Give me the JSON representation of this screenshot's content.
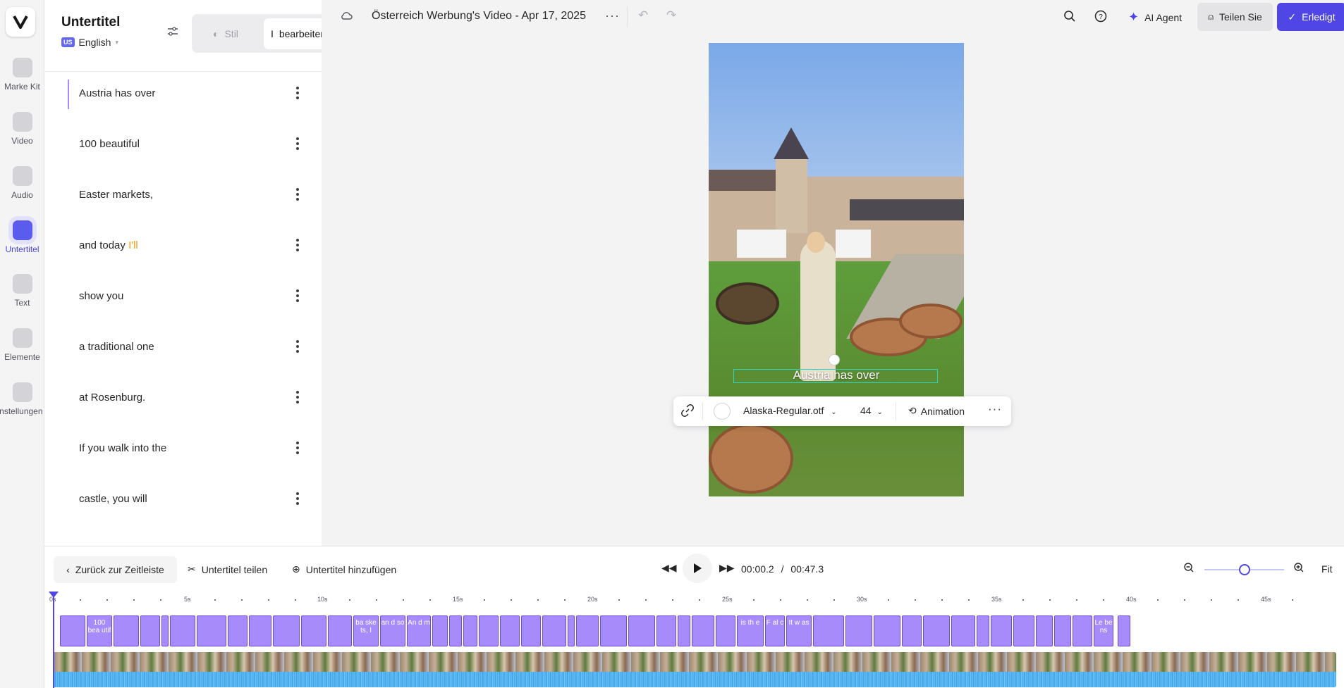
{
  "rail": {
    "items": [
      {
        "label": "Marke Kit",
        "icon": "brand-kit-icon"
      },
      {
        "label": "Video",
        "icon": "video-icon"
      },
      {
        "label": "Audio",
        "icon": "music-icon"
      },
      {
        "label": "Untertitel",
        "icon": "subtitles-icon",
        "active": true
      },
      {
        "label": "Text",
        "icon": "text-icon"
      },
      {
        "label": "Elemente",
        "icon": "elements-icon"
      },
      {
        "label": "Einstellungen",
        "icon": "settings-icon"
      }
    ]
  },
  "panel": {
    "title": "Untertitel",
    "language_code": "US",
    "language": "English",
    "mode_style": "Stil",
    "mode_edit": "bearbeiten",
    "subtitles": [
      {
        "text": "Austria has over",
        "highlight": ""
      },
      {
        "text": "100 beautiful",
        "highlight": ""
      },
      {
        "text": "Easter markets,",
        "highlight": ""
      },
      {
        "text": "and today ",
        "highlight": "I'll"
      },
      {
        "text": "show you",
        "highlight": ""
      },
      {
        "text": "a traditional one",
        "highlight": ""
      },
      {
        "text": "at Rosenburg.",
        "highlight": ""
      },
      {
        "text": "If you walk into the",
        "highlight": ""
      },
      {
        "text": "castle, you will",
        "highlight": ""
      }
    ]
  },
  "topbar": {
    "title": "Österreich Werbung's Video - Apr 17, 2025",
    "ai_agent": "AI Agent",
    "share": "Teilen Sie",
    "done": "Erledigt"
  },
  "preview": {
    "caption": "Austria has over"
  },
  "text_toolbar": {
    "font": "Alaska-Regular.otf",
    "size": "44",
    "animation": "Animation"
  },
  "timeline": {
    "back": "Zurück zur Zeitleiste",
    "split": "Untertitel teilen",
    "add": "Untertitel hinzufügen",
    "current_time": "00:00.2",
    "separator": "/",
    "total_time": "00:47.3",
    "zoom_level": 0.5,
    "fit": "Fit",
    "ruler_labels": [
      "0s",
      "5s",
      "10s",
      "15s",
      "20s",
      "25s",
      "30s",
      "35s",
      "40s",
      "45s"
    ],
    "segment_labels": [
      "100 bea utif",
      "ba ske ts, I",
      "an d so",
      "An d m",
      "is th e",
      "F al c",
      "It w as",
      "Le be ns"
    ]
  },
  "colors": {
    "accent": "#4f46e5",
    "segment": "#a78bfa",
    "highlight_word": "#f59e0b"
  }
}
